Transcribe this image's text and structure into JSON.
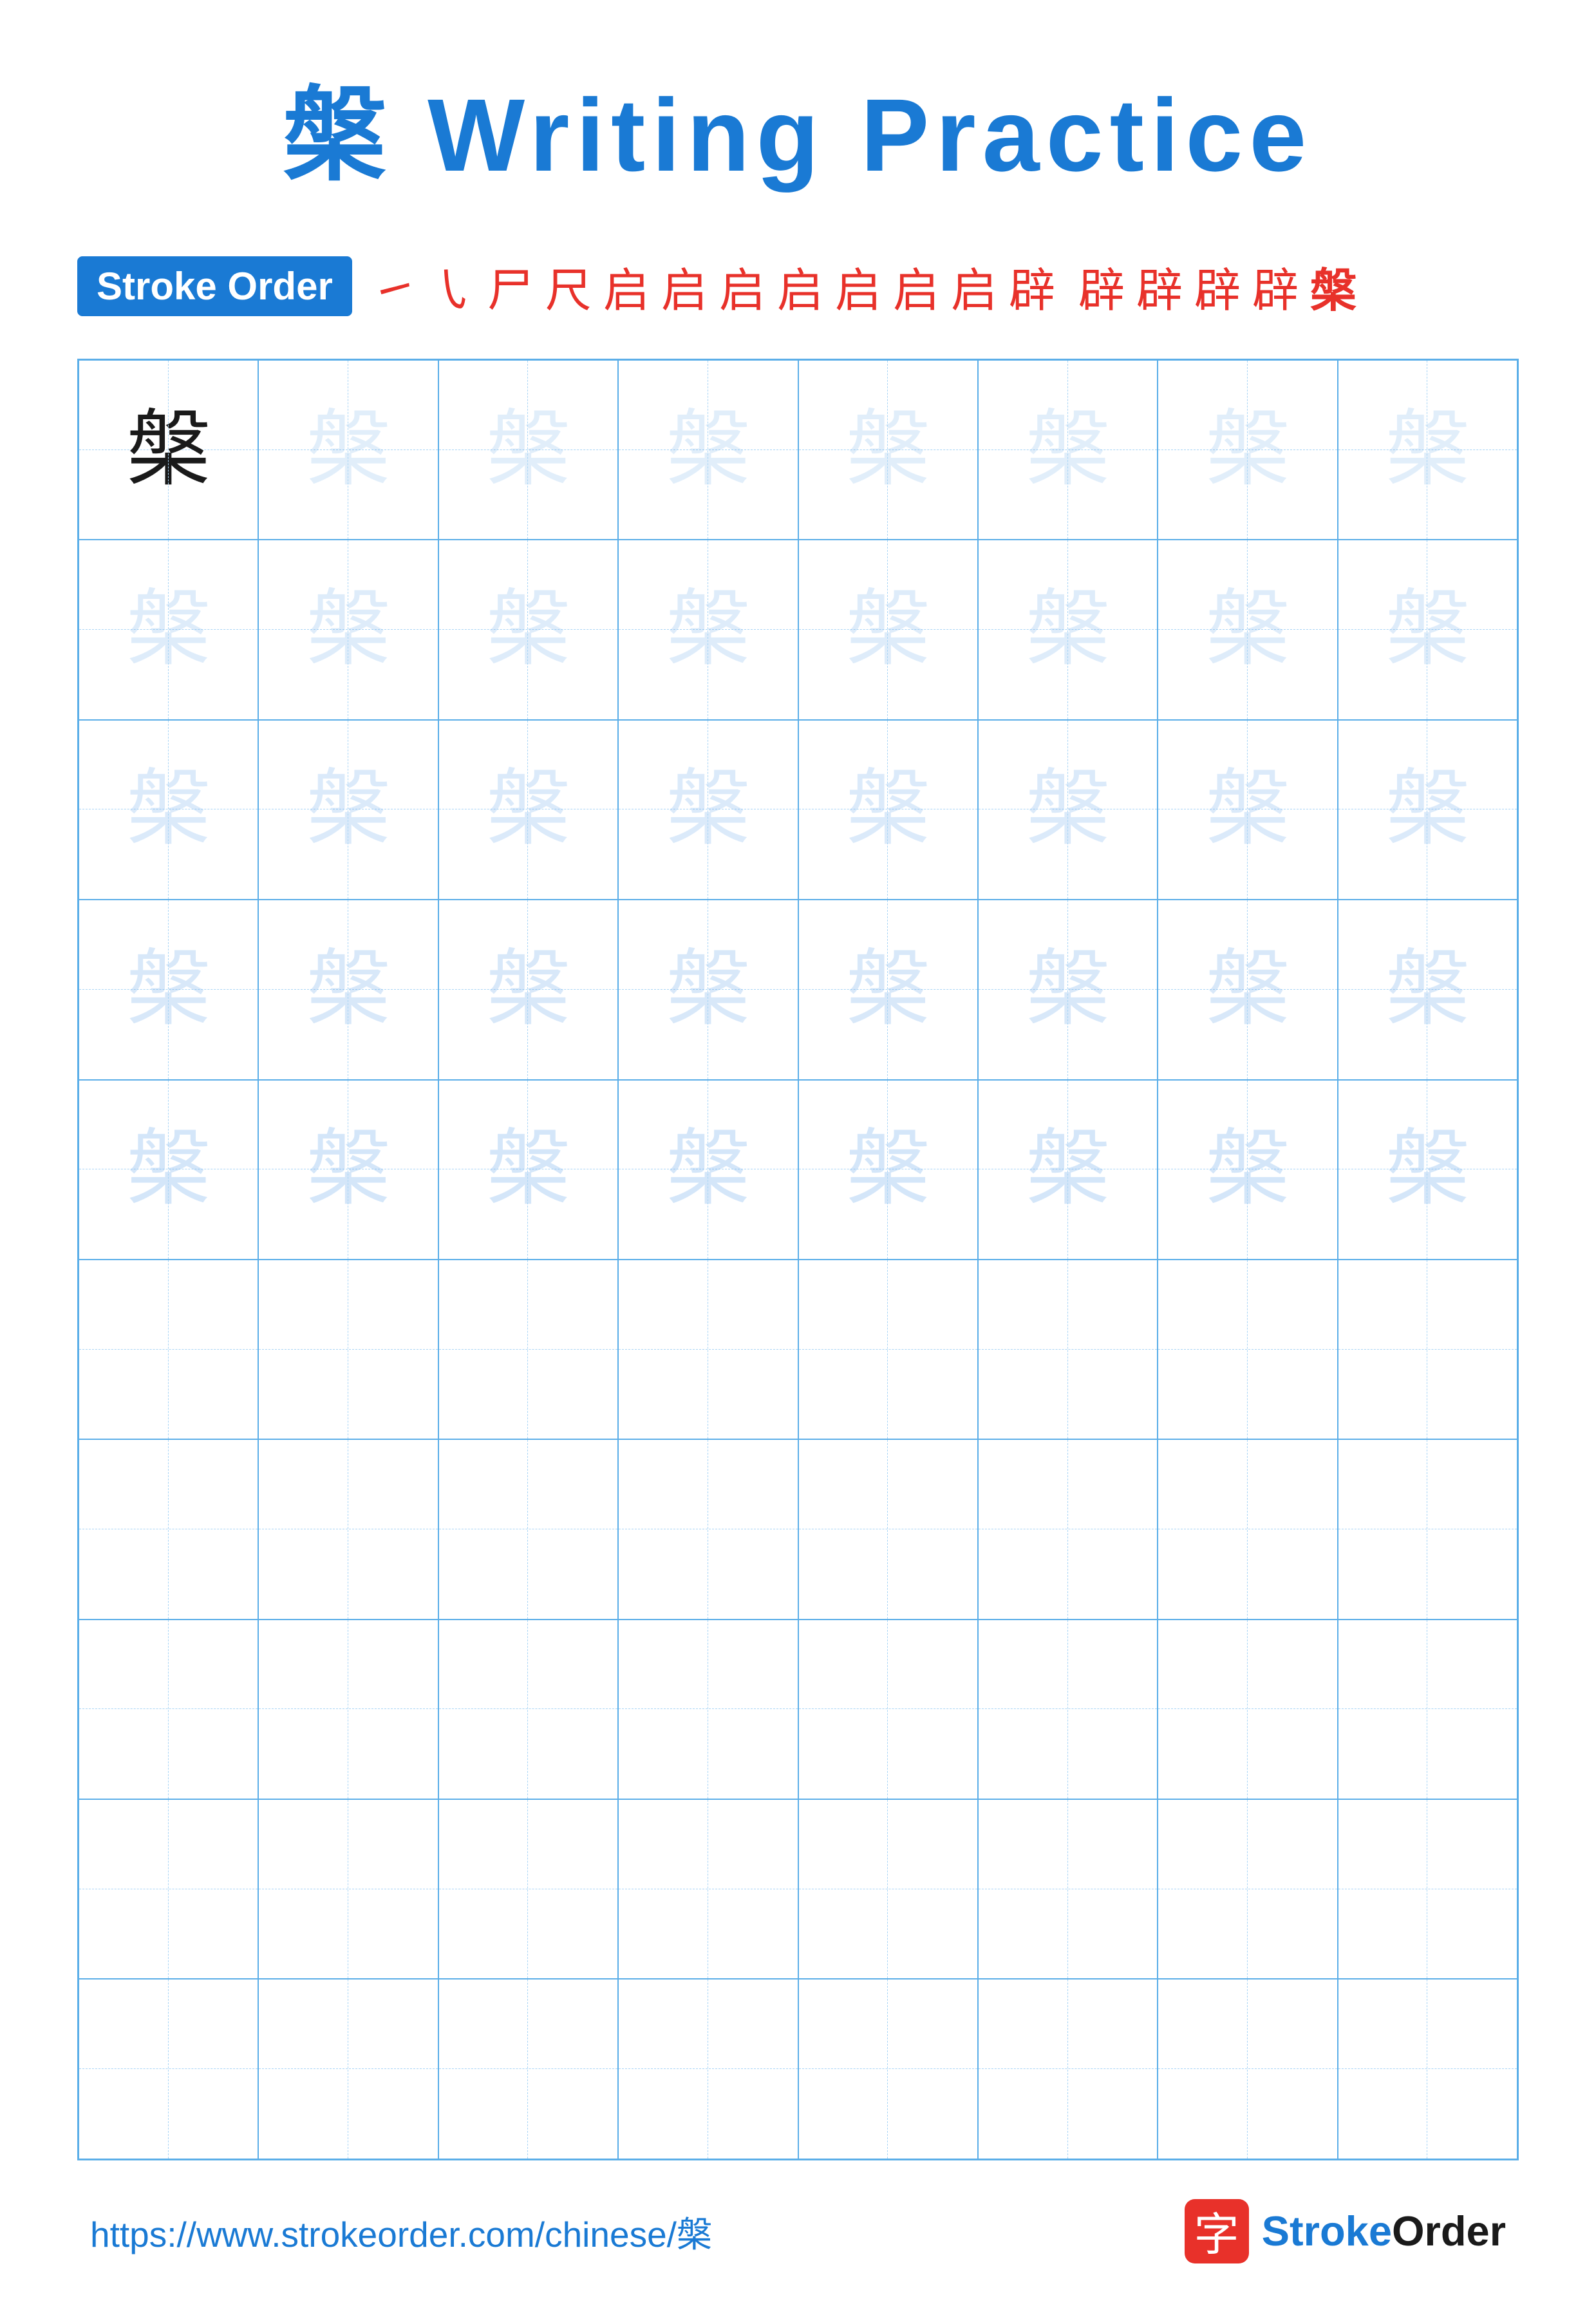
{
  "title": {
    "char": "槃",
    "label": "Writing Practice",
    "full": "槃 Writing Practice"
  },
  "stroke_order": {
    "badge_label": "Stroke Order",
    "strokes": [
      "㇀",
      "㇂",
      "尸",
      "尺",
      "启",
      "启",
      "启`",
      "启˙",
      "启⁺",
      "启⁷",
      "启⁺⁻",
      "辟",
      "辟̣",
      "辟̈",
      "辟̈",
      "槃"
    ]
  },
  "grid": {
    "cols": 8,
    "rows": 10,
    "char": "槃",
    "filled_rows": 5,
    "first_cell_dark": true
  },
  "footer": {
    "url": "https://www.strokeorder.com/chinese/槃",
    "logo_char": "字",
    "logo_text": "StrokeOrder"
  }
}
